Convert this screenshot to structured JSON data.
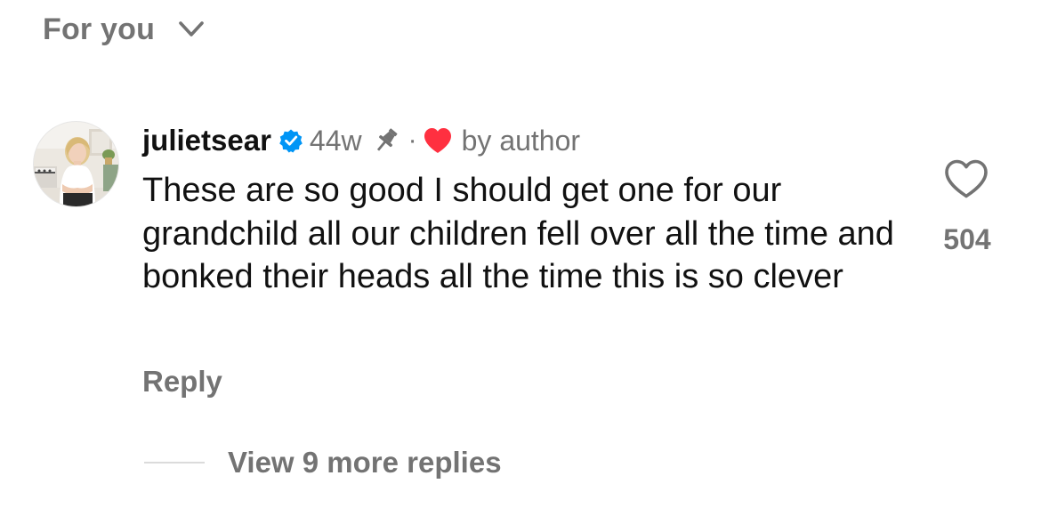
{
  "sort": {
    "label": "For you",
    "icon": "chevron-down-icon"
  },
  "comment": {
    "avatar_icon": "profile-photo",
    "username": "julietsear",
    "verified": true,
    "time": "44w",
    "pinned_icon": "pin-icon",
    "separator": "·",
    "liked_by_author_icon": "heart-filled-icon",
    "liked_by_author_label": "by author",
    "text": "These are so good I should get one for our grandchild all our children fell over all the time and bonked their heads all the time this is so clever",
    "reply_label": "Reply",
    "like_icon": "heart-outline-icon",
    "like_count": "504",
    "view_replies_label": "View 9 more replies"
  },
  "colors": {
    "text_primary": "#111111",
    "text_secondary": "#737373",
    "verified_blue": "#0095f6",
    "heart_red": "#ff3040",
    "divider": "#dbdbdb"
  }
}
